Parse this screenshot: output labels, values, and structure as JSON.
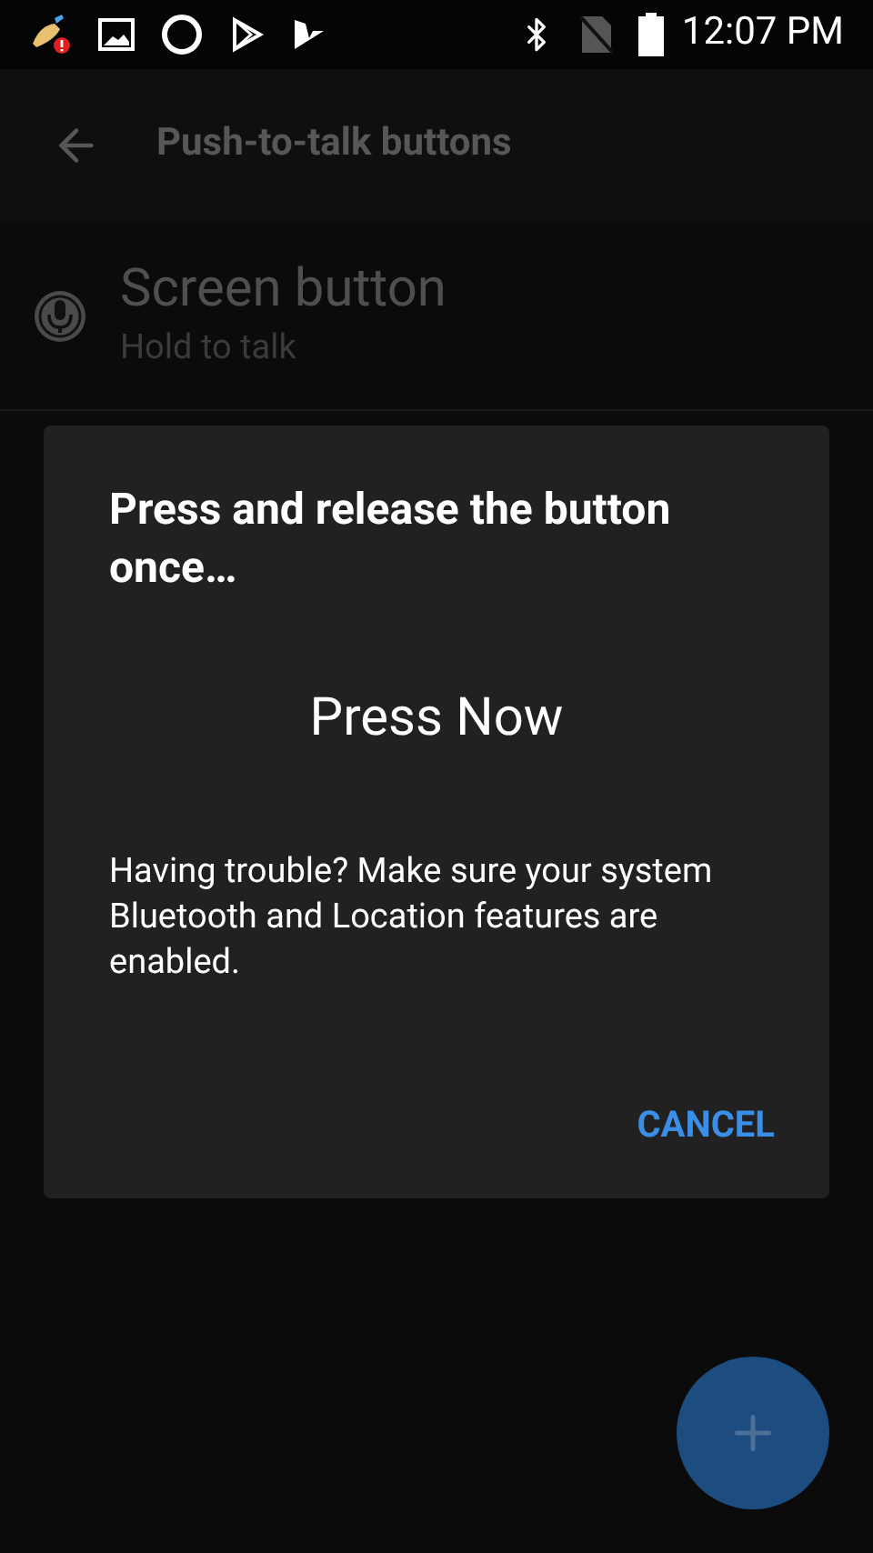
{
  "status_bar": {
    "time": "12:07 PM"
  },
  "toolbar": {
    "title": "Push-to-talk buttons"
  },
  "list": [
    {
      "title": "Screen button",
      "subtitle": "Hold to talk"
    }
  ],
  "dialog": {
    "title": "Press and release the button once…",
    "prompt": "Press Now",
    "message": "Having trouble? Make sure your system Bluetooth and Location features are enabled.",
    "buttons": [
      "CANCEL"
    ]
  }
}
